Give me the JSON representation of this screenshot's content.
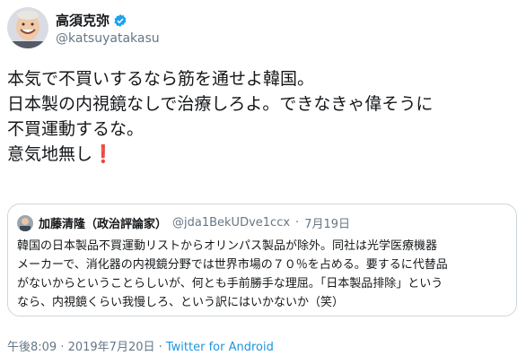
{
  "author": {
    "display_name": "高須克弥",
    "handle": "@katsuyatakasu"
  },
  "tweet": {
    "lines": [
      "本気で不買いするなら筋を通せよ韓国。",
      "日本製の内視鏡なしで治療しろよ。できなきゃ偉そうに",
      "不買運動するな。",
      "意気地無し"
    ],
    "emoji": "❗"
  },
  "quoted": {
    "display_name": "加藤清隆（政治評論家）",
    "handle": "@jda1BekUDve1ccx",
    "separator": "·",
    "date": "7月19日",
    "lines": [
      "韓国の日本製品不買運動リストからオリンパス製品が除外。同社は光学医療機器",
      "メーカーで、消化器の内視鏡分野では世界市場の７０％を占める。要するに代替品",
      "がないからということらしいが、何とも手前勝手な理屈。「日本製品排除」という",
      "なら、内視鏡くらい我慢しろ、という訳にはいかないか（笑）"
    ]
  },
  "footer": {
    "timestamp": "午後8:09 · 2019年7月20日 · ",
    "via": "Twitter for Android"
  },
  "colors": {
    "verified": "#1da1f2",
    "link": "#1b95e0",
    "exclaim": "#dd2e44"
  }
}
